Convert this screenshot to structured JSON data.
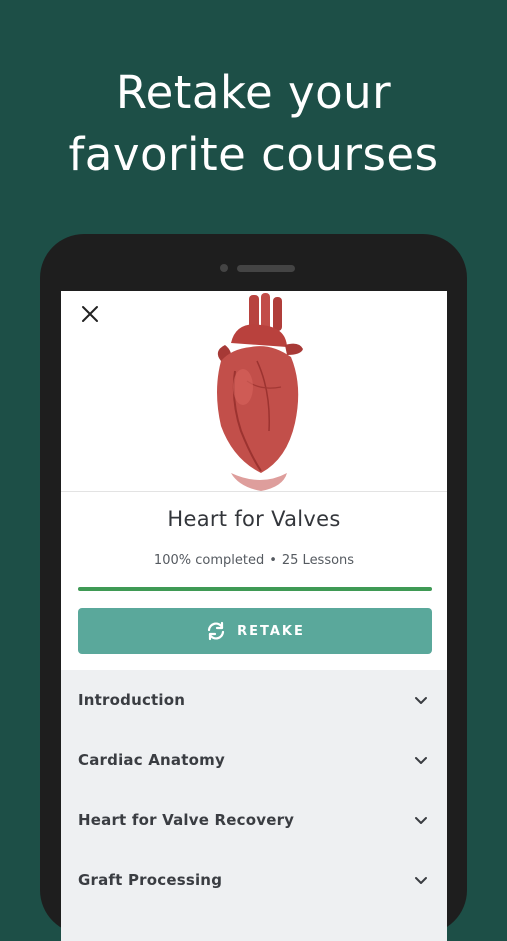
{
  "headline": {
    "line1": "Retake your",
    "line2": "favorite courses"
  },
  "course": {
    "title": "Heart for Valves",
    "completed_text": "100% completed",
    "separator": "•",
    "lessons_text": "25 Lessons",
    "progress_percent": 100,
    "retake_label": "RETAKE"
  },
  "sections": [
    {
      "label": "Introduction",
      "icon": "chevron-down-icon"
    },
    {
      "label": "Cardiac Anatomy",
      "icon": "chevron-down-icon"
    },
    {
      "label": "Heart for Valve Recovery",
      "icon": "chevron-down-icon"
    },
    {
      "label": "Graft Processing",
      "icon": "chevron-down-icon"
    }
  ],
  "colors": {
    "background": "#1d4f47",
    "accent_button": "#5aa89b",
    "progress": "#3f9a55"
  }
}
